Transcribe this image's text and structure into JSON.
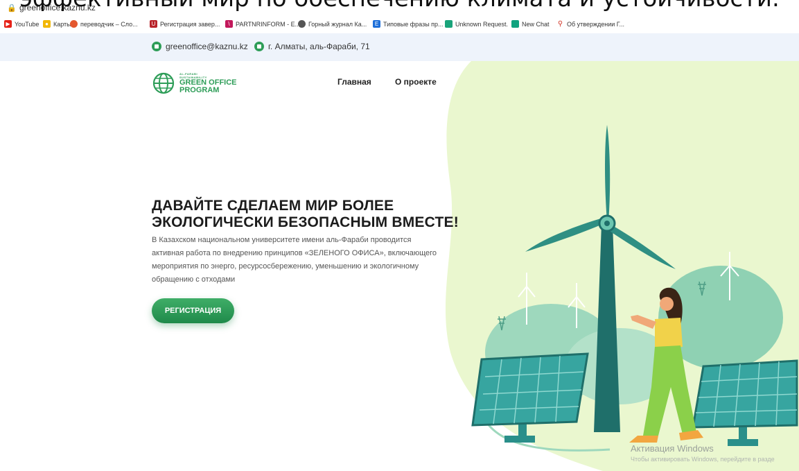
{
  "overlay_caption": "эффективный мир по обеспечению климата и устойчивости.",
  "browser": {
    "url": "greenoffice.kaznu.kz",
    "bookmarks": [
      {
        "label": "YouTube",
        "icon": "youtube-icon",
        "color": "#e62117"
      },
      {
        "label": "Карты",
        "icon": "maps-icon",
        "color": "#f2b705"
      },
      {
        "label": "переводчик – Сло...",
        "icon": "translator-icon",
        "color": "#e4572e"
      },
      {
        "label": "Регистрация завер...",
        "icon": "registration-icon",
        "color": "#b8232a"
      },
      {
        "label": "PARTNRINFORM - E...",
        "icon": "partnrinform-icon",
        "color": "#c2185b"
      },
      {
        "label": "Горный журнал Ка...",
        "icon": "globe-icon",
        "color": "#555555"
      },
      {
        "label": "Типовые фразы пр...",
        "icon": "phrases-icon",
        "color": "#1e6fd9"
      },
      {
        "label": "Unknown Request.",
        "icon": "unknown-request-icon",
        "color": "#1aa37a"
      },
      {
        "label": "New Chat",
        "icon": "chat-icon",
        "color": "#10a37f"
      },
      {
        "label": "Об утверждении Г...",
        "icon": "search-icon",
        "color": "#d33b2c"
      }
    ]
  },
  "contact": {
    "email": "greenoffice@kaznu.kz",
    "address": "г. Алматы, аль-Фараби, 71"
  },
  "logo": {
    "line1": "AL-FARABI",
    "line2": "SUSTAINABILITY",
    "title1": "GREEN OFFICE",
    "title2": "PROGRAM"
  },
  "nav": {
    "home": "Главная",
    "about": "О проекте"
  },
  "hero": {
    "heading_line1": "ДАВАЙТЕ СДЕЛАЕМ МИР БОЛЕЕ",
    "heading_line2": "ЭКОЛОГИЧЕСКИ БЕЗОПАСНЫМ ВМЕСТЕ!",
    "description": "В Казахском национальном университете имени аль-Фараби проводится активная работа по внедрению принципов «ЗЕЛЕНОГО ОФИСА», включающего мероприятия по энерго, ресурсосбережению, уменьшению и экологичному обращению с отходами",
    "button": "РЕГИСТРАЦИЯ"
  },
  "watermark": {
    "title": "Активация Windows",
    "subtitle": "Чтобы активировать Windows, перейдите в разде"
  },
  "colors": {
    "brand_green": "#2e9d58",
    "info_bar": "#eef3fb",
    "turbine_teal": "#1f6f6a",
    "blob_light": "#eaf7cf"
  }
}
